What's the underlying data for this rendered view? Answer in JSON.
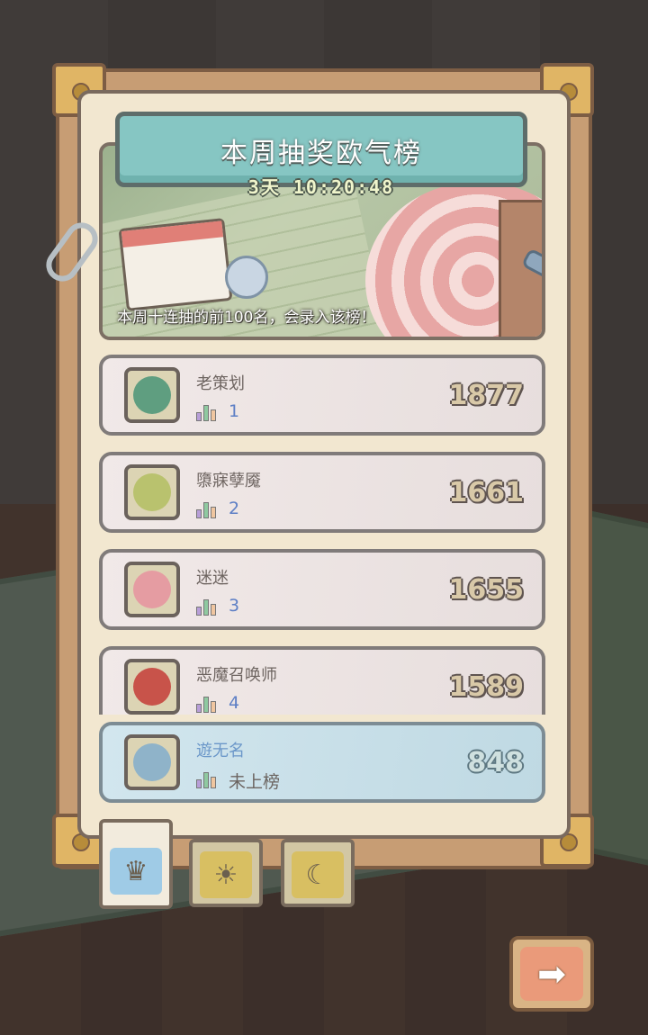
{
  "header": {
    "title": "本周抽奖欧气榜",
    "countdown": "3天 10:20:48",
    "caption": "本周十连抽的前100名，会录入该榜！"
  },
  "leaderboard": [
    {
      "name": "老策划",
      "rank": "1",
      "score": "1877",
      "avatar_icon": "green-monster-icon",
      "avatar_color": "#5f9e80"
    },
    {
      "name": "隳寐孽魇",
      "rank": "2",
      "score": "1661",
      "avatar_icon": "tongue-face-icon",
      "avatar_color": "#b9c26e"
    },
    {
      "name": "迷迷",
      "rank": "3",
      "score": "1655",
      "avatar_icon": "pink-snail-icon",
      "avatar_color": "#e59ca2"
    },
    {
      "name": "恶魔召唤师",
      "rank": "4",
      "score": "1589",
      "avatar_icon": "red-demon-icon",
      "avatar_color": "#c8534a"
    }
  ],
  "me": {
    "name": "遊无名",
    "rank": "未上榜",
    "score": "848",
    "avatar_icon": "grumpy-blue-face-icon",
    "avatar_color": "#8fb3c9"
  },
  "tabs": [
    {
      "icon": "crown-icon",
      "glyph": "♛",
      "active": true
    },
    {
      "icon": "sun-face-icon",
      "glyph": "☀",
      "active": false
    },
    {
      "icon": "moon-face-icon",
      "glyph": "☾",
      "active": false
    }
  ],
  "next_button": {
    "icon": "arrow-right-icon",
    "glyph": "➡"
  }
}
